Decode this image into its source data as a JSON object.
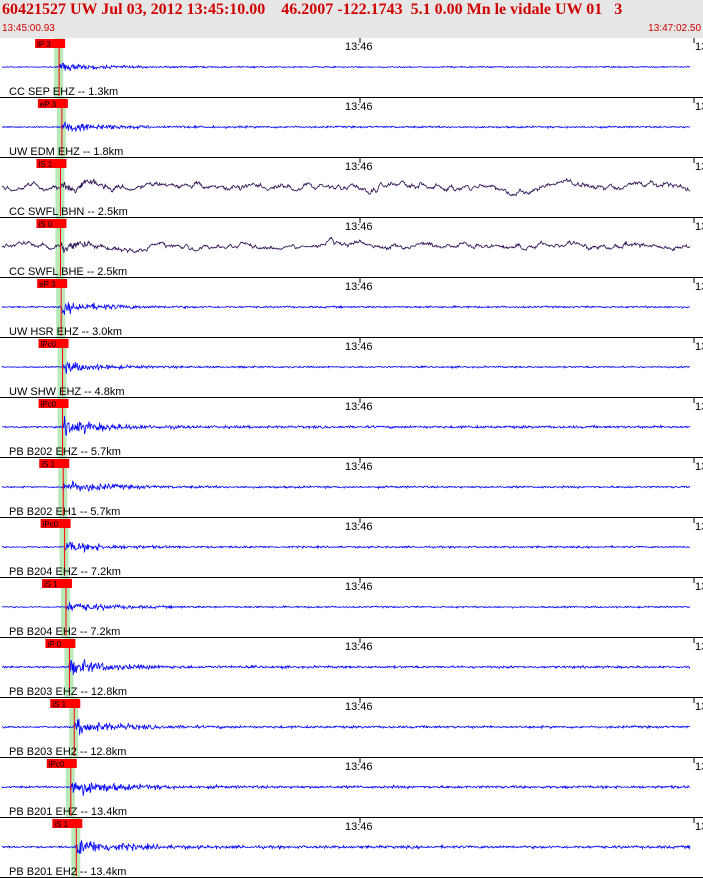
{
  "header": {
    "title": "60421527 UW Jul 03, 2012 13:45:10.00    46.2007 -122.1743  5.1 0.00 Mn le vidale UW 01   3",
    "time_start": "13:45:00.93",
    "time_end": "13:47:02.50"
  },
  "colors": {
    "header_text": "#d00000",
    "trace_vertical": "#0000ff",
    "trace_horizontal": "#2a0a50",
    "pick_box": "#ff0000",
    "pick_band": "#a6e3a6",
    "divider": "#000000"
  },
  "chart_data": {
    "type": "line",
    "x_unit": "time",
    "x_start": "13:45:00.93",
    "x_end": "13:47:02.50",
    "tick_label": "13:46",
    "edge_tick_label": "13",
    "panels": [
      {
        "name": "CC SEP EHZ -- 1.3km",
        "pick": "iP 3",
        "pick_pos": 0.083,
        "amp": 0.4,
        "color": "#0000ff"
      },
      {
        "name": "UW EDM EHZ -- 1.8km",
        "pick": "eP 3",
        "pick_pos": 0.087,
        "amp": 0.55,
        "color": "#0000ff"
      },
      {
        "name": "CC SWFL BHN -- 2.5km",
        "pick": "iS 1",
        "pick_pos": 0.085,
        "amp": 0.7,
        "color": "#2a0a50"
      },
      {
        "name": "CC SWFL BHE -- 2.5km",
        "pick": "iS 0",
        "pick_pos": 0.085,
        "amp": 0.65,
        "color": "#2a0a50"
      },
      {
        "name": "UW HSR EHZ -- 3.0km",
        "pick": "eP 3",
        "pick_pos": 0.086,
        "amp": 0.55,
        "color": "#0000ff"
      },
      {
        "name": "UW SHW EHZ -- 4.8km",
        "pick": "iPc0",
        "pick_pos": 0.088,
        "amp": 0.5,
        "color": "#0000ff"
      },
      {
        "name": "PB B202 EHZ -- 5.7km",
        "pick": "iPc0",
        "pick_pos": 0.088,
        "amp": 0.75,
        "color": "#0000ff"
      },
      {
        "name": "PB B202 EH1 -- 5.7km",
        "pick": "iS 1",
        "pick_pos": 0.089,
        "amp": 0.6,
        "color": "#0000ff"
      },
      {
        "name": "PB B204 EHZ -- 7.2km",
        "pick": "iPc0",
        "pick_pos": 0.091,
        "amp": 0.55,
        "color": "#0000ff"
      },
      {
        "name": "PB B204 EH2 -- 7.2km",
        "pick": "iS 1",
        "pick_pos": 0.093,
        "amp": 0.5,
        "color": "#0000ff"
      },
      {
        "name": "PB B203 EHZ -- 12.8km",
        "pick": "iP 0",
        "pick_pos": 0.098,
        "amp": 0.7,
        "color": "#0000ff"
      },
      {
        "name": "PB B203 EH2 -- 12.8km",
        "pick": "iS 1",
        "pick_pos": 0.105,
        "amp": 0.7,
        "color": "#0000ff"
      },
      {
        "name": "PB B201 EHZ -- 13.4km",
        "pick": "iPc0",
        "pick_pos": 0.1,
        "amp": 0.8,
        "color": "#0000ff"
      },
      {
        "name": "PB B201 EH2 -- 13.4km",
        "pick": "iS 1",
        "pick_pos": 0.108,
        "amp": 0.8,
        "color": "#0000ff"
      }
    ]
  }
}
